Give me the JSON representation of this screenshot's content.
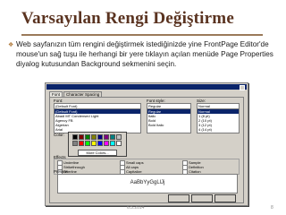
{
  "slide": {
    "title": "Varsayılan Rengi Değiştirme",
    "bullet": "Web sayfanızın tüm rengini değiştirmek istediğinizde yine FrontPage Editor'de mouse'un sağ tuşu ile herhangi bir yere tıklayın açılan menüde Page Properties diyalog kutusundan Background sekmenini seçin.",
    "date": "6.5.2014",
    "page_number": "8"
  },
  "dialog": {
    "tabs": [
      "Font",
      "Character Spacing"
    ],
    "font_label": "Font:",
    "font_value": "(Default Font)",
    "font_list": [
      "(Default Font)",
      "Abadi MT Condensed Light",
      "Agency FB",
      "Algerian",
      "Arial"
    ],
    "style_label": "Font style:",
    "style_value": "Regular",
    "style_list": [
      "Regular",
      "Italic",
      "Bold",
      "Bold Italic"
    ],
    "size_label": "Size:",
    "size_value": "Normal",
    "size_list": [
      "Normal",
      "1 (8 pt)",
      "2 (10 pt)",
      "3 (12 pt)",
      "4 (14 pt)"
    ],
    "color_label": "Color:",
    "more_colors": "More Colors...",
    "effects_label": "Effects",
    "effects_left": [
      "Underline",
      "Strikethrough",
      "Overline",
      "Blink",
      "Superscript",
      "Subscript"
    ],
    "effects_right": [
      "Small caps",
      "All caps",
      "Capitalize",
      "Hidden",
      "Strong",
      "Emphasis"
    ],
    "effects_right2": [
      "Sample",
      "Definition",
      "Citation",
      "Variable",
      "Keyboard",
      "Code"
    ],
    "preview_label": "Preview",
    "preview_text": "AaBbYyGgLlJj",
    "buttons": [
      "OK",
      "Cancel",
      "Apply"
    ],
    "palette_colors": [
      "#000000",
      "#800000",
      "#008000",
      "#808000",
      "#000080",
      "#800080",
      "#008080",
      "#c0c0c0",
      "#808080",
      "#ff0000",
      "#00ff00",
      "#ffff00",
      "#0000ff",
      "#ff00ff",
      "#00ffff",
      "#ffffff"
    ]
  }
}
